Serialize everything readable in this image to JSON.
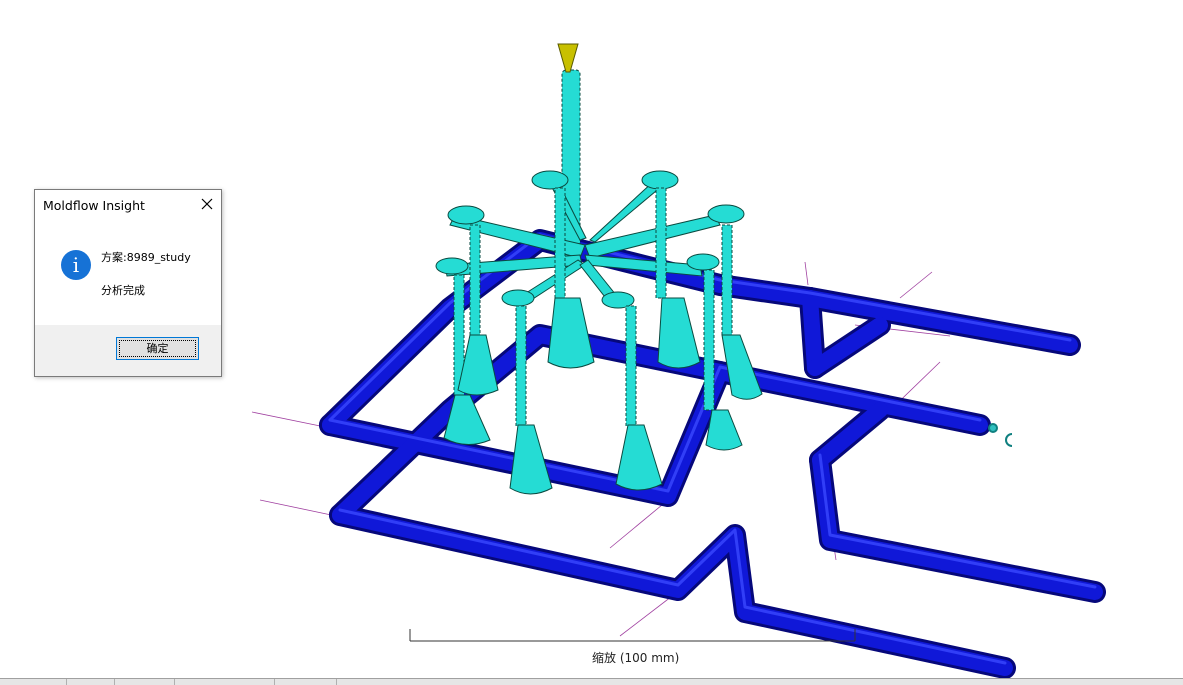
{
  "dialog": {
    "title": "Moldflow Insight",
    "message_line1": "方案:8989_study",
    "message_line2": "分析完成",
    "ok_label": "确定",
    "icon": "info-icon",
    "close_icon": "close-icon"
  },
  "viewport": {
    "scale_label": "缩放 (100 mm)",
    "colors": {
      "cooling_channel": "#0a10c8",
      "mesh": "#20d6d0",
      "sprue_tip": "#c8c000",
      "axis_lines": "#a040a0"
    }
  }
}
